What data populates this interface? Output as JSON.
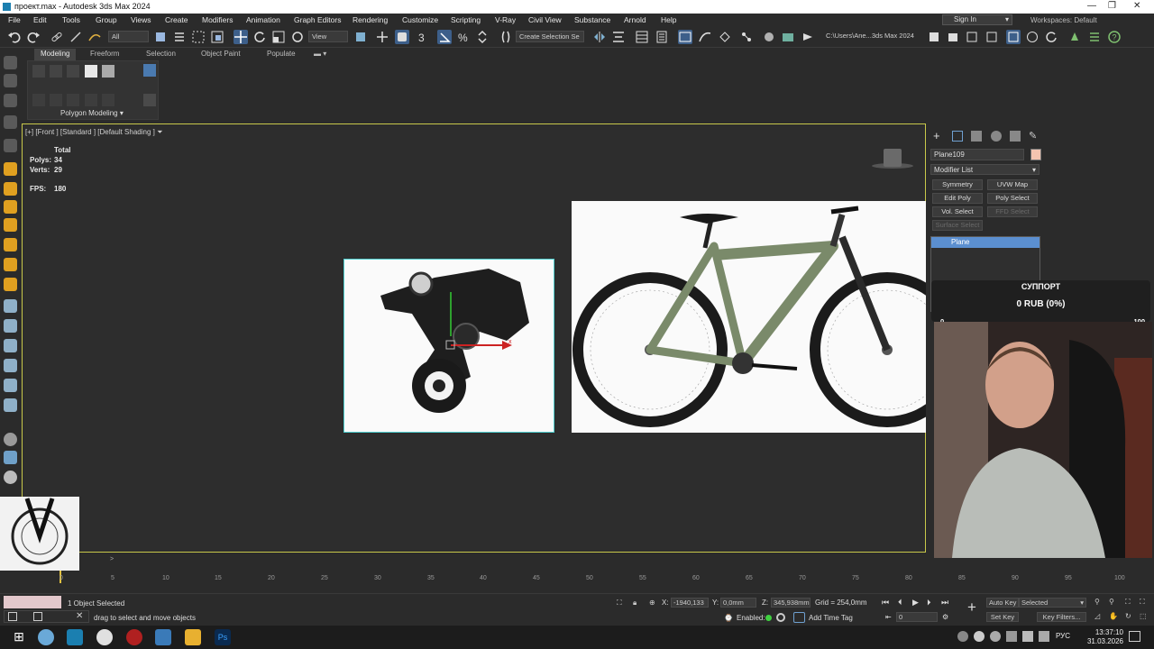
{
  "window": {
    "title": "проект.max - Autodesk 3ds Max 2024",
    "min": "—",
    "max": "❐",
    "close": "✕"
  },
  "menu": [
    "File",
    "Edit",
    "Tools",
    "Group",
    "Views",
    "Create",
    "Modifiers",
    "Animation",
    "Graph Editors",
    "Rendering",
    "Customize",
    "Scripting",
    "V-Ray",
    "Civil View",
    "Substance",
    "Arnold",
    "Help"
  ],
  "account": {
    "signin": "Sign In",
    "workspaces": "Workspaces: Default"
  },
  "toolbar": {
    "filter": "All",
    "refcoord": "View",
    "selection_set": "Create Selection Se",
    "path": "C:\\Users\\Ane...3ds Max 2024"
  },
  "ribbon": {
    "tabs": [
      "Modeling",
      "Freeform",
      "Selection",
      "Object Paint",
      "Populate"
    ],
    "panel": "Polygon Modeling"
  },
  "viewport": {
    "label": "[+] [Front ] [Standard ] [Default Shading ]",
    "stats": {
      "total": "Total",
      "polys_label": "Polys:",
      "polys": "34",
      "verts_label": "Verts:",
      "verts": "29",
      "fps_label": "FPS:",
      "fps": "180"
    },
    "gizmo_x": "x"
  },
  "command_panel": {
    "object_name": "Plane109",
    "modifier_list": "Modifier List",
    "buttons": [
      {
        "label": "Symmetry",
        "enabled": true
      },
      {
        "label": "UVW Map",
        "enabled": true
      },
      {
        "label": "Edit Poly",
        "enabled": true
      },
      {
        "label": "Poly Select",
        "enabled": true
      },
      {
        "label": "Vol. Select",
        "enabled": true
      },
      {
        "label": "FFD Select",
        "enabled": false
      },
      {
        "label": "Surface Select",
        "enabled": false
      }
    ],
    "stack": [
      "Plane"
    ],
    "object_color": "#f5c4b0"
  },
  "overlay": {
    "title": "СУППОРТ",
    "amount": "0 RUB (0%)",
    "min": "0",
    "max": "100",
    "progress": 0
  },
  "timeline": {
    "slider": "0 / 100",
    "ticks": [
      "0",
      "5",
      "10",
      "15",
      "20",
      "25",
      "30",
      "35",
      "40",
      "45",
      "50",
      "55",
      "60",
      "65",
      "70",
      "75",
      "80",
      "85",
      "90",
      "95",
      "100"
    ]
  },
  "status": {
    "selected": "1 Object Selected",
    "prompt": "drag to select and move objects",
    "x_label": "X:",
    "x": "-1940,133",
    "y_label": "Y:",
    "y": "0,0mm",
    "z_label": "Z:",
    "z": "345,938mm",
    "grid": "Grid = 254,0mm",
    "enabled": "Enabled:",
    "add_time_tag": "Add Time Tag",
    "frame": "0",
    "auto_key": "Auto Key",
    "set_key": "Set Key",
    "key_mode": "Selected",
    "key_filters": "Key Filters..."
  },
  "taskbar": {
    "lang": "РУС",
    "time": "13:37:10",
    "date": "31.03.2026"
  }
}
